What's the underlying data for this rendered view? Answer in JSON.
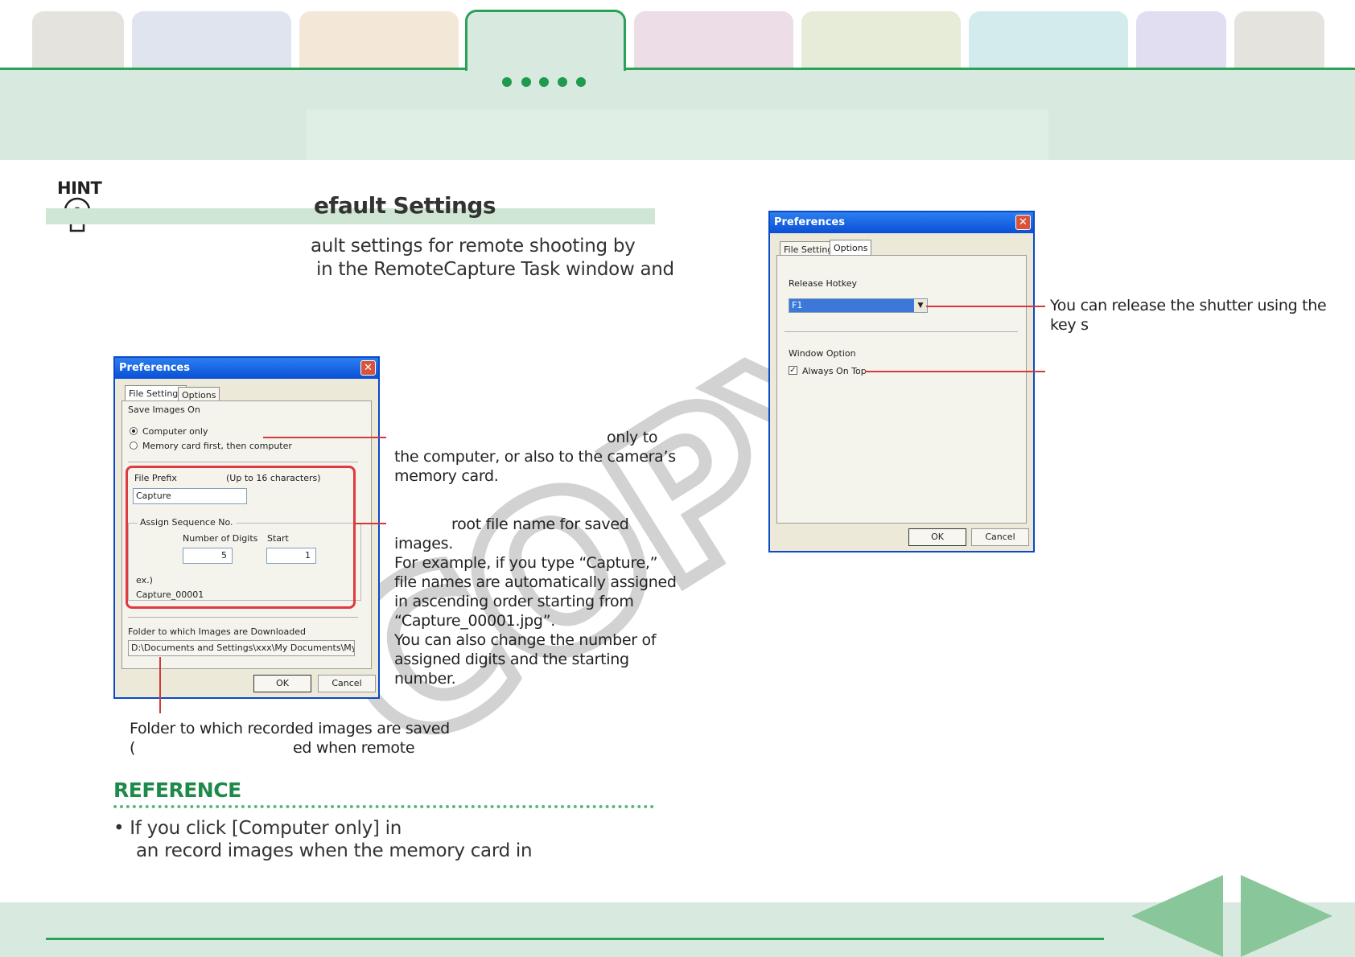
{
  "header": {
    "tab_colors": [
      "#e5e3de",
      "#dfe4ee",
      "#f3e7d8",
      "#d8eadf",
      "#ecdde6",
      "#e6ecd8",
      "#d4ebee",
      "#e0def0",
      "#e5e3de"
    ],
    "accent_color": "#2aa258"
  },
  "hint": {
    "label": "HINT",
    "title": "efault Settings",
    "line1": "ault settings for remote shooting by",
    "line2": " in the RemoteCapture Task window and"
  },
  "dialog_left": {
    "title": "Preferences",
    "tab_file_settings": "File Settings",
    "tab_options": "Options",
    "save_images_on": "Save Images On",
    "radio_computer_only": "Computer only",
    "radio_memory_card": "Memory card first, then computer",
    "file_prefix_label": "File Prefix",
    "file_prefix_hint": "(Up to 16 characters)",
    "file_prefix_value": "Capture",
    "assign_sequence": "Assign Sequence No.",
    "number_of_digits": "Number of Digits",
    "start": "Start",
    "digits_value": "5",
    "start_value": "1",
    "example_label": "ex.)",
    "example_value": "Capture_00001",
    "folder_label": "Folder to which Images are Downloaded",
    "folder_value": "D:\\Documents and Settings\\xxx\\My Documents\\My Pictur",
    "ok": "OK",
    "cancel": "Cancel"
  },
  "dialog_right": {
    "title": "Preferences",
    "tab_file_settings": "File Settings",
    "tab_options": "Options",
    "release_hotkey": "Release Hotkey",
    "hotkey_value": "F1",
    "window_option": "Window Option",
    "always_on_top": "Always On Top",
    "ok": "OK",
    "cancel": "Cancel"
  },
  "annotations": {
    "a1_l1": "only to",
    "a1_l2": "the computer, or also to the camera’s",
    "a1_l3": "memory card.",
    "a2_l1": "root file name for saved",
    "a2_l2": "images.",
    "a2_l3": "For example, if you type “Capture,”",
    "a2_l4": "file names are automatically assigned",
    "a2_l5": "in ascending order starting from",
    "a2_l6": "“Capture_00001.jpg”.",
    "a2_l7": "You can also change the number of",
    "a2_l8": "assigned digits and the starting",
    "a2_l9": "number.",
    "folder_l1": "Folder to which recorded images are saved",
    "folder_l2a": "(",
    "folder_l2b": "ed when remote",
    "right_l1": "You can release the shutter using the",
    "right_l2": "key s"
  },
  "reference": {
    "title": "REFERENCE",
    "line1": "• If you click [Computer only] in",
    "line2": "an record images when the memory card in"
  },
  "watermark": "COPY",
  "nav": {
    "prev": "previous-page",
    "next": "next-page"
  }
}
